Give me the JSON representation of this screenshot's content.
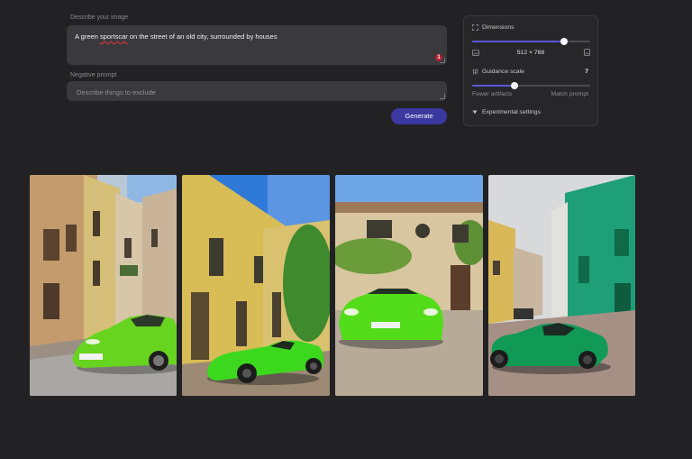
{
  "prompt": {
    "label": "Describe your image",
    "value_start": "A green ",
    "value_misspelled": "sportscar",
    "value_end": " on the street of an old city, surrounded by houses",
    "error_count": "1"
  },
  "negative": {
    "label": "Negative prompt",
    "placeholder": "Describe things to exclude"
  },
  "generate_label": "Generate",
  "settings": {
    "dimensions": {
      "label": "Dimensions",
      "value": "512 × 768",
      "slider_fraction": 0.78
    },
    "guidance": {
      "label": "Guidance scale",
      "value": "7",
      "left_hint": "Fewer artifacts",
      "right_hint": "Match prompt",
      "slider_fraction": 0.36
    },
    "experimental_label": "Experimental settings"
  },
  "images": [
    {
      "car_color": "#67d41f"
    },
    {
      "car_color": "#3cd81e"
    },
    {
      "car_color": "#52dc1a"
    },
    {
      "car_color": "#119a55"
    }
  ]
}
